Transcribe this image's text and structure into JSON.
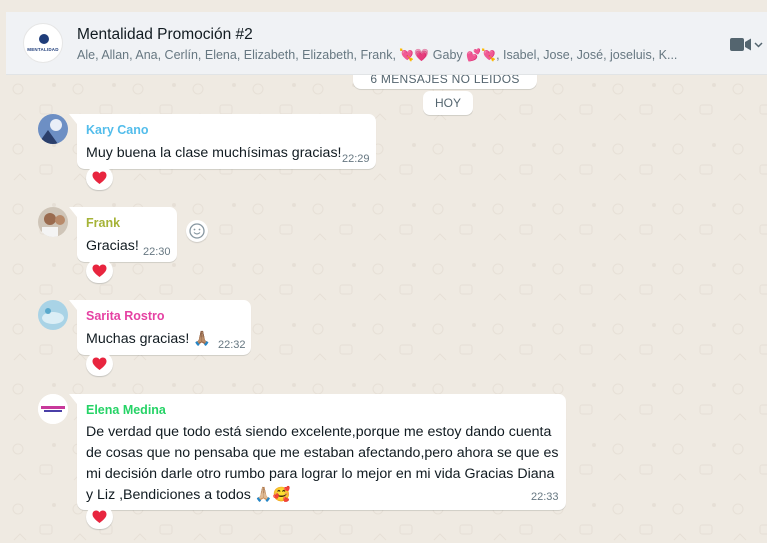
{
  "header": {
    "title": "Mentalidad Promoción #2",
    "avatar_text": "MENTALIDAD",
    "members_before": "Ale, Allan, Ana, Cerlín, Elena, Elizabeth, Elizabeth, Frank,",
    "members_emoji1": "💘💗",
    "members_mid": "Gaby",
    "members_emoji2": "💕💘",
    "members_after": ", Isabel, Jose, José, joseluis, K..."
  },
  "unread_banner": "6 MENSAJES NO LEIDOS",
  "day_label": "HOY",
  "messages": [
    {
      "sender": "Kary Cano",
      "sender_color": "#53bdeb",
      "text": "Muy buena la clase muchísimas gracias!",
      "time": "22:29",
      "reaction": "heart"
    },
    {
      "sender": "Frank",
      "sender_color": "#a5b337",
      "text": "Gracias!",
      "time": "22:30",
      "reaction": "heart"
    },
    {
      "sender": "Sarita Rostro",
      "sender_color": "#e542a3",
      "text": "Muchas gracias! 🙏🏽",
      "time": "22:32",
      "reaction": "heart"
    },
    {
      "sender": "Elena Medina",
      "sender_color": "#25d366",
      "lines": [
        "De verdad que todo está siendo excelente,porque me estoy dando cuenta",
        "de cosas que no pensaba que me estaban afectando,pero ahora se que es",
        "mi decisión darle otro rumbo para lograr lo mejor en mi vida Gracias Diana",
        "y Liz ,Bendiciones a todos 🙏🏼🥰"
      ],
      "time": "22:33",
      "reaction": "heart"
    }
  ],
  "colors": {
    "heart": "#e8253f",
    "chat_bg": "#efeae2",
    "header_bg": "#f0f2f5"
  },
  "icons": [
    "video-call-icon",
    "chevron-down-icon",
    "emoji-reaction-icon",
    "heart-icon"
  ]
}
